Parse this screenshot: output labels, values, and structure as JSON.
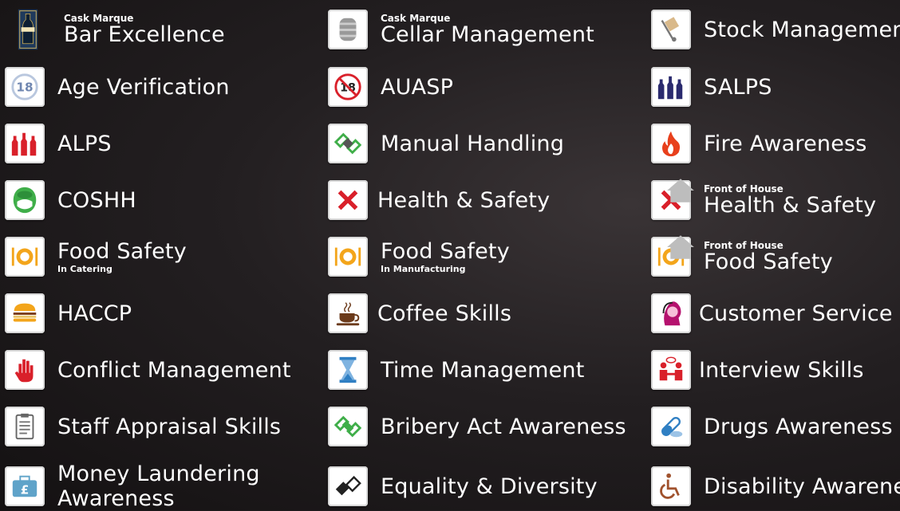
{
  "columns": [
    {
      "items": [
        {
          "pre": "Cask Marque",
          "title": "Bar Excellence",
          "sub": "",
          "icon": "cask-marque-logo-icon"
        },
        {
          "pre": "",
          "title": "Age Verification",
          "sub": "",
          "icon": "age-18-icon"
        },
        {
          "pre": "",
          "title": "ALPS",
          "sub": "",
          "icon": "red-bottles-icon"
        },
        {
          "pre": "",
          "title": "COSHH",
          "sub": "",
          "icon": "mask-face-icon"
        },
        {
          "pre": "",
          "title": "Food Safety",
          "sub": "In Catering",
          "icon": "plate-cutlery-icon"
        },
        {
          "pre": "",
          "title": "HACCP",
          "sub": "",
          "icon": "burger-icon"
        },
        {
          "pre": "",
          "title": "Conflict Management",
          "sub": "",
          "icon": "stop-hand-icon"
        },
        {
          "pre": "",
          "title": "Staff Appraisal Skills",
          "sub": "",
          "icon": "clipboard-icon"
        },
        {
          "pre": "",
          "title": "Money Laundering Awareness",
          "sub": "",
          "icon": "pound-briefcase-icon"
        }
      ]
    },
    {
      "items": [
        {
          "pre": "Cask Marque",
          "title": "Cellar Management",
          "sub": "",
          "icon": "keg-icon"
        },
        {
          "pre": "",
          "title": "AUASP",
          "sub": "",
          "icon": "no-under-18-icon"
        },
        {
          "pre": "",
          "title": "Manual Handling",
          "sub": "",
          "icon": "lifting-hands-icon"
        },
        {
          "pre": "",
          "title": "Health & Safety",
          "sub": "",
          "icon": "red-cross-icon"
        },
        {
          "pre": "",
          "title": "Food Safety",
          "sub": "In Manufacturing",
          "icon": "plate-cutlery-icon"
        },
        {
          "pre": "",
          "title": "Coffee Skills",
          "sub": "",
          "icon": "coffee-cup-icon"
        },
        {
          "pre": "",
          "title": "Time Management",
          "sub": "",
          "icon": "hourglass-icon"
        },
        {
          "pre": "",
          "title": "Bribery Act Awareness",
          "sub": "",
          "icon": "money-handshake-icon"
        },
        {
          "pre": "",
          "title": "Equality & Diversity",
          "sub": "",
          "icon": "handshake-icon"
        }
      ]
    },
    {
      "items": [
        {
          "pre": "",
          "title": "Stock Management",
          "sub": "",
          "icon": "hand-truck-icon"
        },
        {
          "pre": "",
          "title": "SALPS",
          "sub": "",
          "icon": "blue-bottles-icon"
        },
        {
          "pre": "",
          "title": "Fire Awareness",
          "sub": "",
          "icon": "flame-icon"
        },
        {
          "pre": "Front of House",
          "title": "Health & Safety",
          "sub": "",
          "icon": "red-cross-icon"
        },
        {
          "pre": "Front of House",
          "title": "Food Safety",
          "sub": "",
          "icon": "plate-cutlery-icon"
        },
        {
          "pre": "",
          "title": "Customer Service",
          "sub": "",
          "icon": "headset-person-icon"
        },
        {
          "pre": "",
          "title": "Interview Skills",
          "sub": "",
          "icon": "interview-icon"
        },
        {
          "pre": "",
          "title": "Drugs Awareness",
          "sub": "",
          "icon": "pills-icon"
        },
        {
          "pre": "",
          "title": "Disability Awareness",
          "sub": "",
          "icon": "wheelchair-icon"
        }
      ]
    }
  ],
  "colors": {
    "background": "#231f21",
    "red": "#d9202a",
    "navy": "#2a2a6e",
    "green": "#3fae49",
    "orange": "#f3a51b",
    "blue": "#2f7fc3"
  }
}
